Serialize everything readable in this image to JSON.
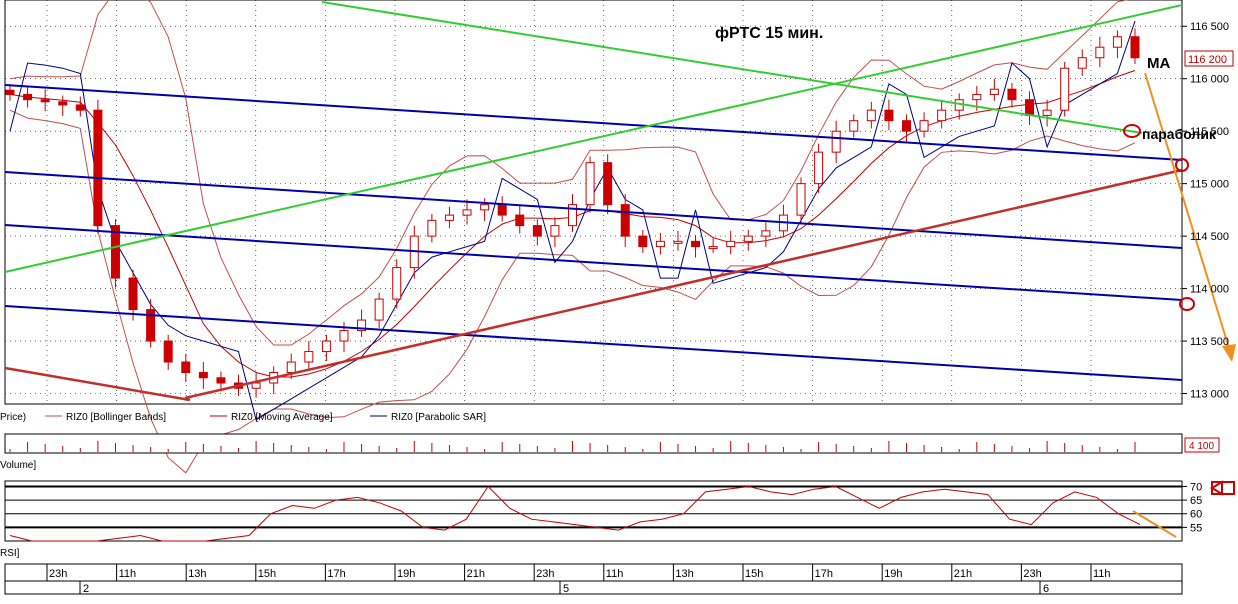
{
  "annotations": {
    "title": "фРТС   15 мин.",
    "ma_label": "MA",
    "parabolic_label": "параболик"
  },
  "legend": {
    "price": "Price)",
    "bollinger": "RIZ0 [Bollinger Bands]",
    "moving_average": "RIZ0 [Moving Average]",
    "parabolic_sar": "RIZ0 [Parabolic SAR]"
  },
  "panels": {
    "volume_label": "Volume]",
    "volume_value": "4 100",
    "rsi_label": "RSI]",
    "price_label": "116 200"
  },
  "colors": {
    "candle_up": "#cc0000",
    "candle_down": "#cc0000",
    "bollinger": "#c0504d",
    "moving_average": "#c00000",
    "parabolic_sar": "#000080",
    "channel_lines": "#0000aa",
    "green_lines": "#33cc33",
    "support_line": "#c0302a",
    "forecast_arrow": "#f0901e",
    "grid": "#000000"
  },
  "chart_data": [
    {
      "type": "candlestick",
      "title": "фРТС   15 мин.",
      "y_ticks": [
        113000,
        113500,
        114000,
        114500,
        115000,
        115500,
        116000,
        116500
      ],
      "y_tick_labels": [
        "113 000",
        "113 500",
        "114 000",
        "114 500",
        "115 000",
        "115 500",
        "116 000",
        "116 500"
      ],
      "ylim": [
        112900,
        116750
      ],
      "last_price": 116200,
      "time_labels": [
        "23h",
        "11h",
        "13h",
        "15h",
        "17h",
        "19h",
        "21h",
        "23h",
        "11h",
        "13h",
        "15h",
        "17h",
        "19h",
        "21h",
        "23h",
        "11h"
      ],
      "day_labels": [
        "2",
        "5",
        "6"
      ],
      "legend": [
        "Price",
        "RIZ0 [Bollinger Bands]",
        "RIZ0 [Moving Average]",
        "RIZ0 [Parabolic SAR]"
      ],
      "close_series_approx": [
        115850,
        115800,
        115780,
        115750,
        115700,
        114600,
        114100,
        113800,
        113500,
        113300,
        113200,
        113150,
        113100,
        113050,
        113100,
        113200,
        113300,
        113400,
        113500,
        113600,
        113700,
        113900,
        114200,
        114500,
        114650,
        114700,
        114750,
        114800,
        114700,
        114600,
        114500,
        114600,
        114800,
        115200,
        114800,
        114500,
        114400,
        114450,
        114450,
        114400,
        114400,
        114450,
        114500,
        114550,
        114700,
        115000,
        115300,
        115500,
        115600,
        115700,
        115600,
        115500,
        115600,
        115700,
        115800,
        115850,
        115900,
        115800,
        115650,
        115700,
        116100,
        116200,
        116300,
        116400,
        116200
      ],
      "annotations": [
        "MA",
        "параболик"
      ]
    },
    {
      "type": "bar",
      "name": "Volume",
      "last_value": 4100
    },
    {
      "type": "line",
      "name": "RSI",
      "y_ticks": [
        55,
        60,
        65,
        70
      ],
      "ylim": [
        50,
        72
      ],
      "values_approx": [
        52,
        50,
        50,
        50,
        50,
        51,
        52,
        50,
        50,
        50,
        51,
        52,
        60,
        63,
        62,
        65,
        66,
        64,
        61,
        55,
        54,
        58,
        70,
        62,
        58,
        57,
        56,
        55,
        54,
        57,
        58,
        60,
        68,
        69,
        70,
        68,
        67,
        69,
        70,
        66,
        62,
        66,
        68,
        69,
        68,
        67,
        58,
        56,
        64,
        68,
        66,
        60,
        56
      ]
    }
  ]
}
